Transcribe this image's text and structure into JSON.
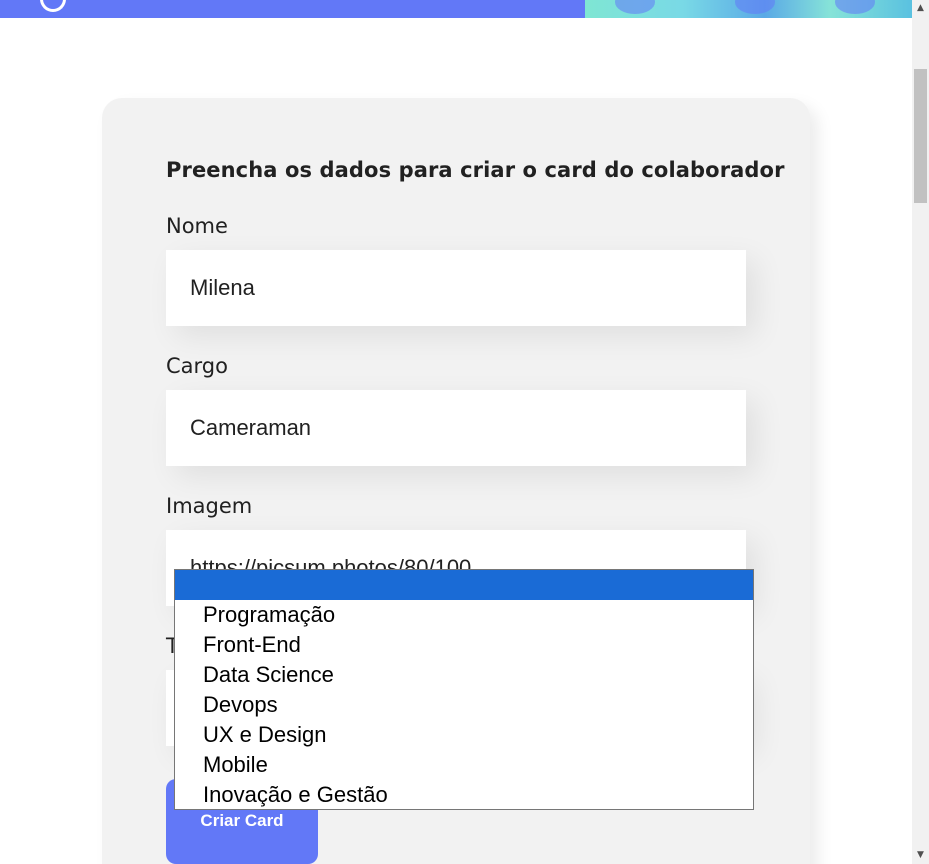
{
  "form": {
    "title": "Preencha os dados para criar o card do colaborador",
    "fields": {
      "nome": {
        "label": "Nome",
        "value": "Milena"
      },
      "cargo": {
        "label": "Cargo",
        "value": "Cameraman"
      },
      "imagem": {
        "label": "Imagem",
        "value": "https://picsum.photos/80/100"
      },
      "time": {
        "label_visible_fragment": "T",
        "selected": ""
      }
    },
    "submit_label": "Criar Card"
  },
  "dropdown": {
    "options": [
      "",
      "Programação",
      "Front-End",
      "Data Science",
      "Devops",
      "UX e Design",
      "Mobile",
      "Inovação e Gestão"
    ],
    "selected_index": 0
  },
  "colors": {
    "accent": "#6278f7",
    "selection": "#1a6bd6",
    "card_bg": "#f2f2f2"
  },
  "icons": {
    "scroll_up": "scroll-up-arrow-icon",
    "scroll_down": "scroll-down-arrow-icon"
  }
}
